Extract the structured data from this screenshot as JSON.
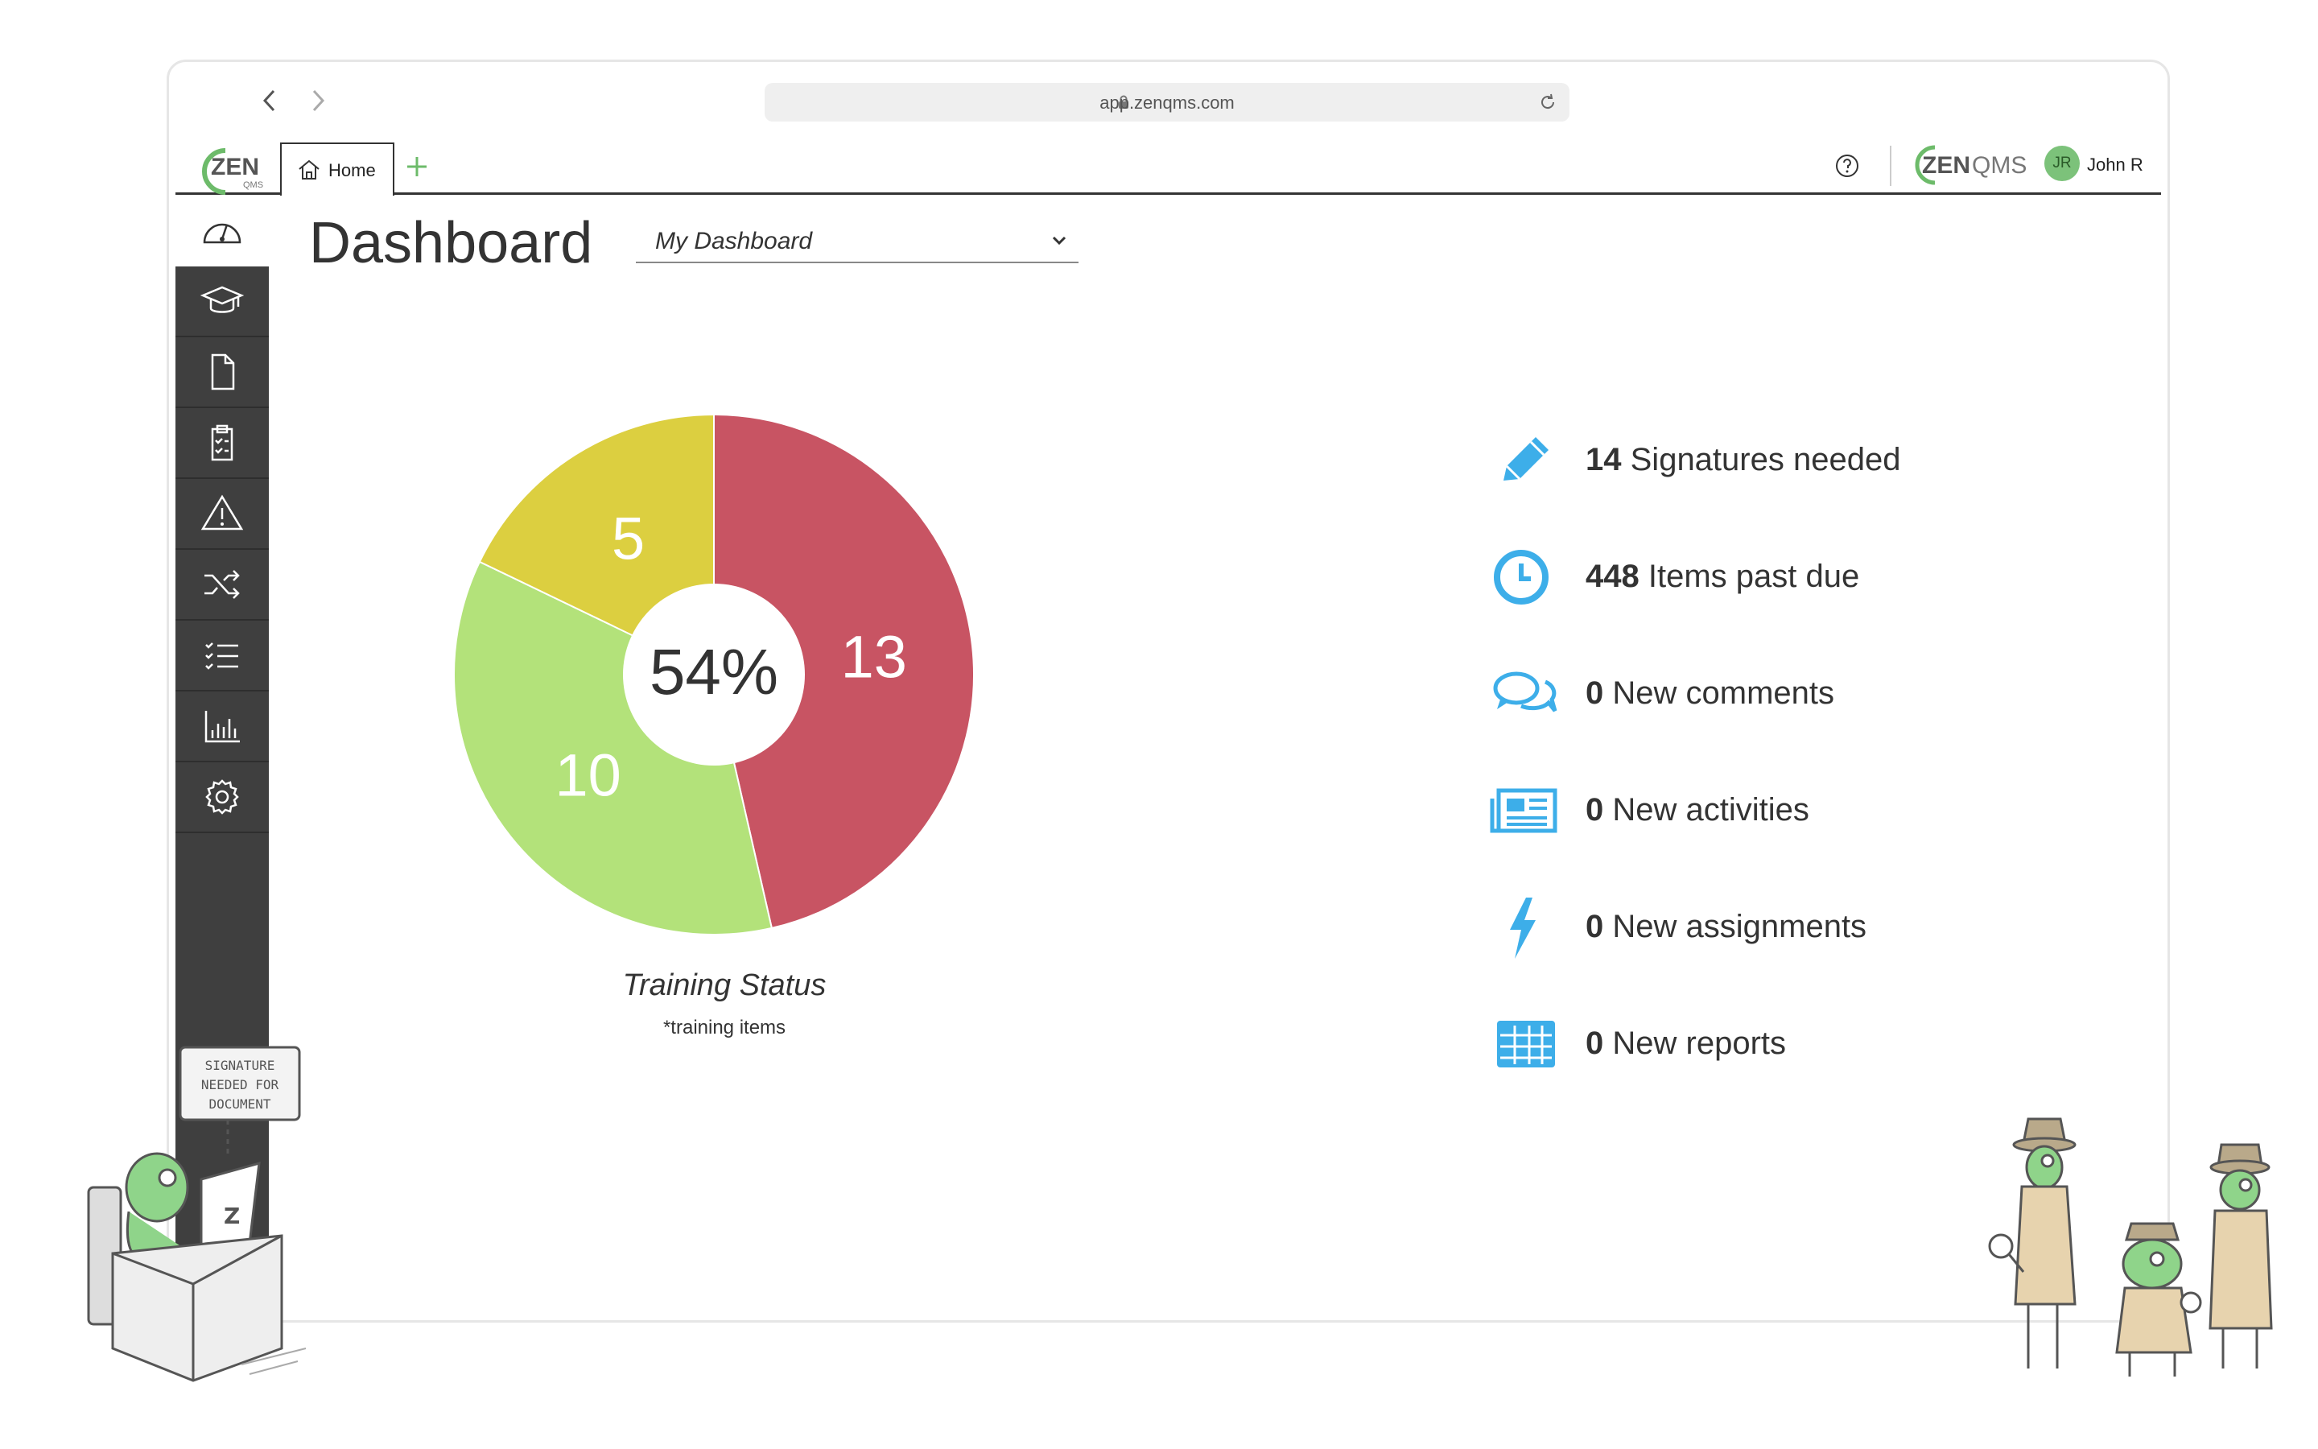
{
  "browser": {
    "url": "app.zenqms.com"
  },
  "header": {
    "logo_text": "ZEN",
    "logo_sub": "QMS",
    "home_tab_label": "Home",
    "brand_text": "ZEN",
    "brand_suffix": "QMS",
    "user_initials": "JR",
    "user_name": "John R"
  },
  "sidebar": {
    "items": [
      {
        "name": "dashboard",
        "icon": "gauge-icon"
      },
      {
        "name": "training",
        "icon": "graduation-cap-icon"
      },
      {
        "name": "documents",
        "icon": "document-icon"
      },
      {
        "name": "audits",
        "icon": "clipboard-checklist-icon"
      },
      {
        "name": "events",
        "icon": "warning-triangle-icon"
      },
      {
        "name": "change",
        "icon": "shuffle-icon"
      },
      {
        "name": "tasks",
        "icon": "checklist-icon"
      },
      {
        "name": "reports",
        "icon": "bar-chart-icon"
      },
      {
        "name": "settings",
        "icon": "gear-icon"
      }
    ]
  },
  "main": {
    "title": "Dashboard",
    "dashboard_select": "My Dashboard"
  },
  "chart_data": {
    "type": "pie",
    "title": "Training Status",
    "subtitle": "*training items",
    "center_label": "54%",
    "slices": [
      {
        "label": "13",
        "value": 13,
        "color": "#c85463"
      },
      {
        "label": "10",
        "value": 10,
        "color": "#b3e27a"
      },
      {
        "label": "5",
        "value": 5,
        "color": "#dccf40"
      }
    ]
  },
  "stats": [
    {
      "count": "14",
      "label": "Signatures needed",
      "icon": "pencil-icon"
    },
    {
      "count": "448",
      "label": "Items past due",
      "icon": "clock-icon"
    },
    {
      "count": "0",
      "label": "New comments",
      "icon": "comments-icon"
    },
    {
      "count": "0",
      "label": "New activities",
      "icon": "newspaper-icon"
    },
    {
      "count": "0",
      "label": "New assignments",
      "icon": "lightning-icon"
    },
    {
      "count": "0",
      "label": "New reports",
      "icon": "table-icon"
    }
  ],
  "illustration": {
    "sign_text": "SIGNATURE NEEDED FOR DOCUMENT"
  },
  "colors": {
    "accent_blue": "#3daee9",
    "sidebar": "#3f3f3f",
    "brand_green": "#6dbb6a"
  }
}
